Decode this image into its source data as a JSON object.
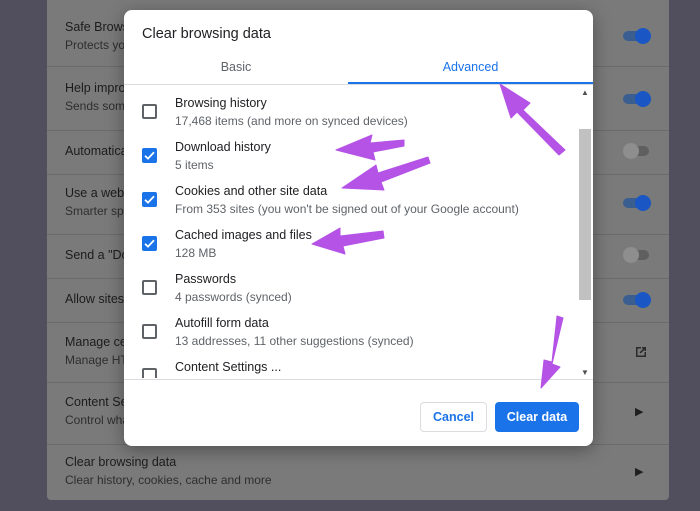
{
  "background": {
    "rows": [
      {
        "title": "Safe Brows",
        "subtitle": "Protects yo",
        "control": "toggle-on"
      },
      {
        "title": "Help impro",
        "subtitle": "Sends som",
        "control": "toggle-on"
      },
      {
        "title": "Automatica",
        "subtitle": "",
        "control": "toggle-off"
      },
      {
        "title": "Use a web",
        "subtitle": "Smarter sp",
        "control": "toggle-on"
      },
      {
        "title": "Send a \"Do",
        "subtitle": "",
        "control": "toggle-off"
      },
      {
        "title": "Allow sites",
        "subtitle": "",
        "control": "toggle-on"
      },
      {
        "title": "Manage ce",
        "subtitle": "Manage HT",
        "control": "external-link-icon"
      },
      {
        "title": "Content Se",
        "subtitle": "Control wha",
        "control": "arrow-right-icon"
      },
      {
        "title": "Clear browsing data",
        "subtitle": "Clear history, cookies, cache and more",
        "control": "arrow-right-icon"
      }
    ]
  },
  "dialog": {
    "title": "Clear browsing data",
    "tabs": [
      {
        "label": "Basic",
        "active": false
      },
      {
        "label": "Advanced",
        "active": true
      }
    ],
    "items": [
      {
        "label": "Browsing history",
        "sublabel": "17,468 items (and more on synced devices)",
        "checked": false
      },
      {
        "label": "Download history",
        "sublabel": "5 items",
        "checked": true
      },
      {
        "label": "Cookies and other site data",
        "sublabel": "From 353 sites (you won't be signed out of your Google account)",
        "checked": true
      },
      {
        "label": "Cached images and files",
        "sublabel": "128 MB",
        "checked": true
      },
      {
        "label": "Passwords",
        "sublabel": "4 passwords (synced)",
        "checked": false
      },
      {
        "label": "Autofill form data",
        "sublabel": "13 addresses, 11 other suggestions (synced)",
        "checked": false
      },
      {
        "label": "Content Settings ...",
        "sublabel": "",
        "checked": false
      }
    ],
    "cancel_label": "Cancel",
    "clear_label": "Clear data"
  },
  "colors": {
    "accent": "#1a73e8",
    "annotation_arrow": "#b553e6",
    "overlay_background": "#7a7a7a"
  }
}
